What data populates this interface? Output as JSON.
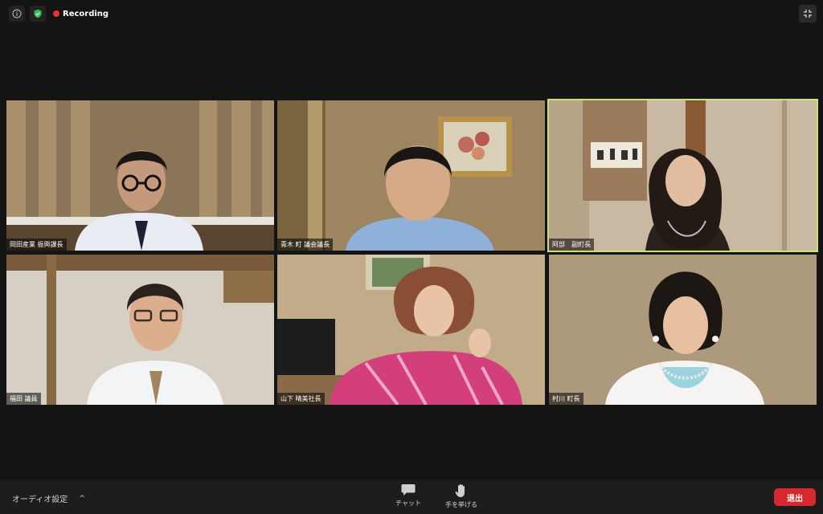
{
  "top_bar": {
    "recording_label": "Recording",
    "icons": [
      "info-icon",
      "shield-check-icon",
      "recording-dot-icon",
      "exit-fullscreen-icon"
    ]
  },
  "participants": [
    {
      "name": "岡田産業 振興課長",
      "active_speaker": false
    },
    {
      "name": "青木 町 議会議長",
      "active_speaker": false
    },
    {
      "name": "阿部　副町長",
      "active_speaker": true
    },
    {
      "name": "福田 議員",
      "active_speaker": false
    },
    {
      "name": "山下 晴美社長",
      "active_speaker": false
    },
    {
      "name": "村川 町長",
      "active_speaker": false
    }
  ],
  "toolbar": {
    "audio_settings_label": "オーディオ設定",
    "audio_caret": "^",
    "chat_label": "チャット",
    "raise_hand_label": "手を挙げる",
    "leave_label": "退出"
  },
  "colors": {
    "background": "#141414",
    "active_speaker_border": "#c9e36b",
    "recording_dot": "#e8312f",
    "leave_button": "#d7282f"
  }
}
